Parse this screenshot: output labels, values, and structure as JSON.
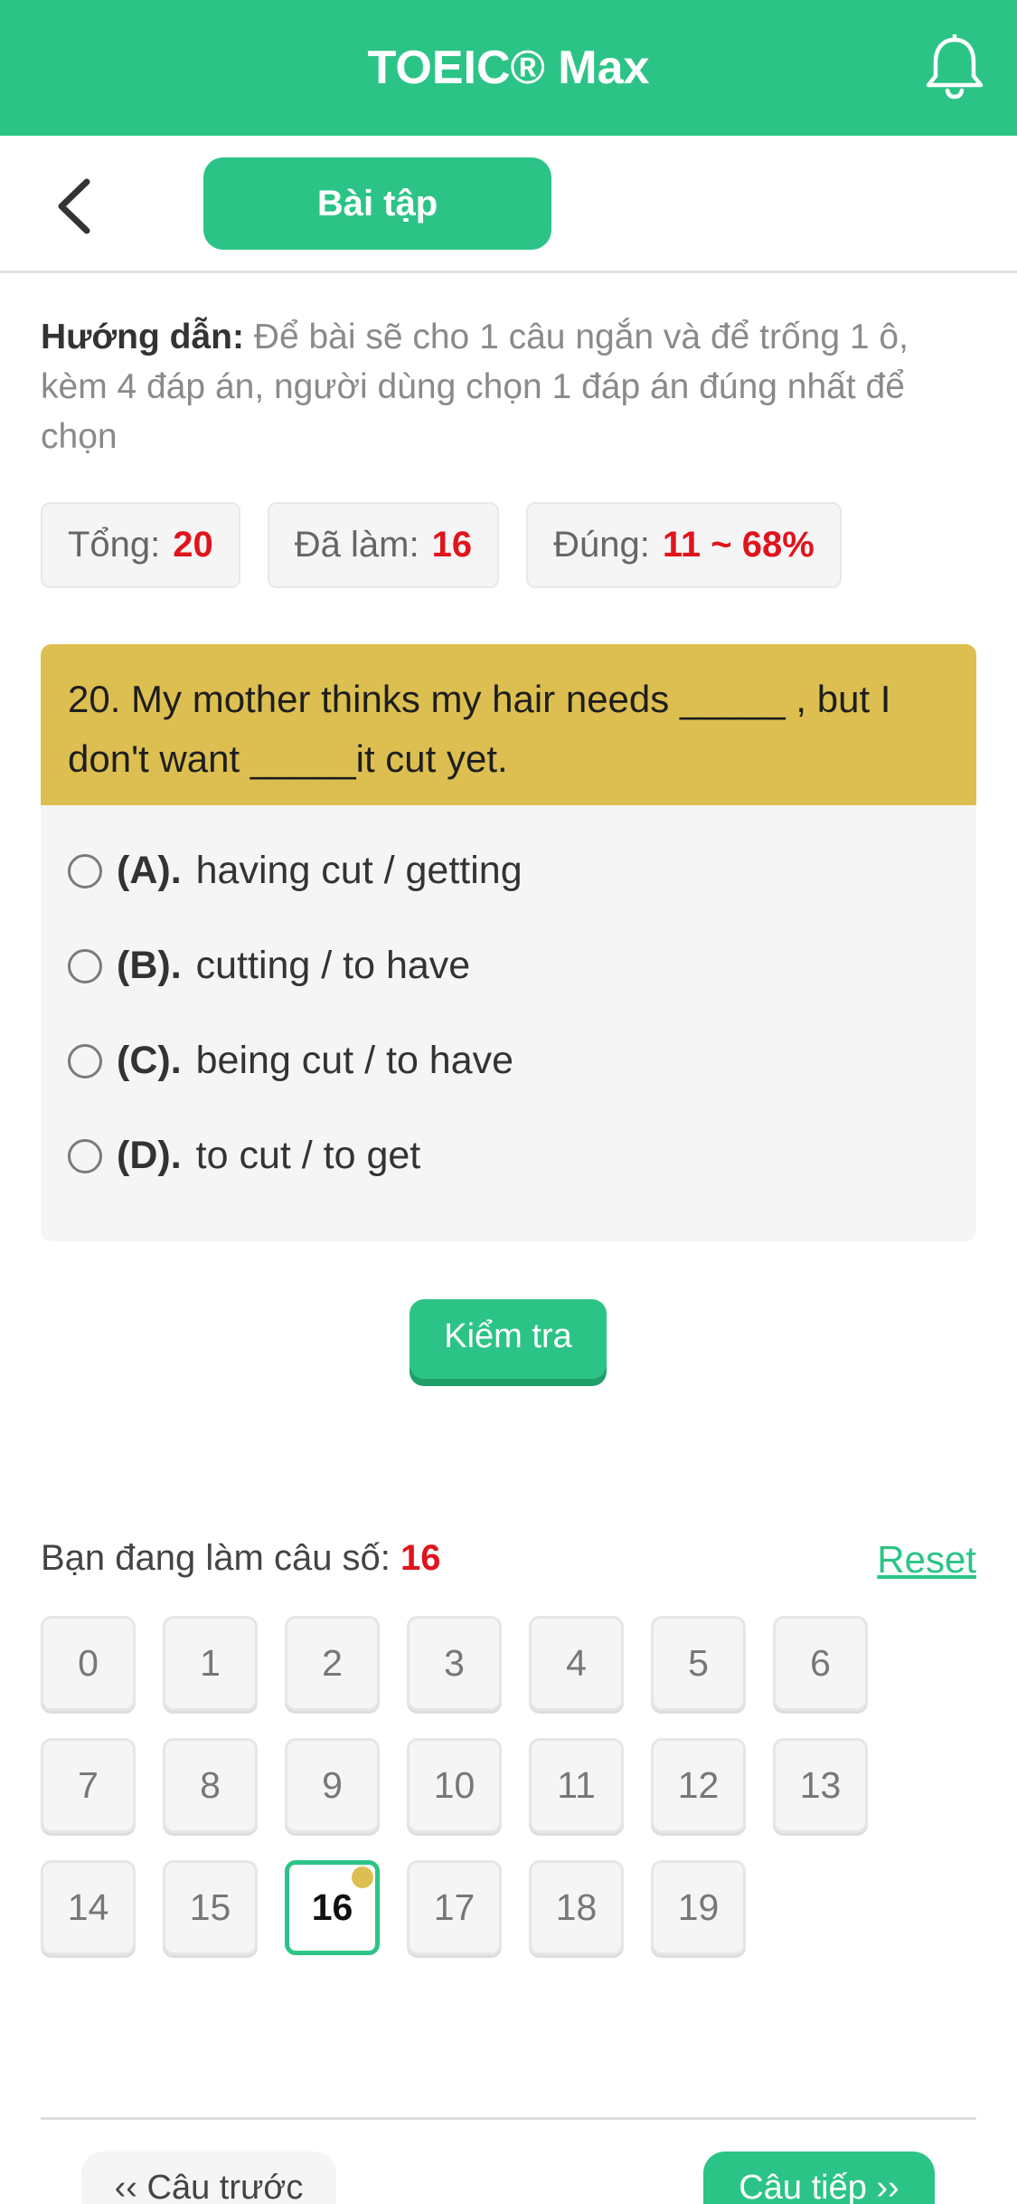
{
  "header": {
    "title": "TOEIC® Max",
    "notification_icon": "bell-icon",
    "brand_color": "#2cc486"
  },
  "subnav": {
    "back_icon": "chevron-left-icon",
    "tab_label": "Bài tập"
  },
  "guide": {
    "label": "Hướng dẫn:",
    "text": " Để bài sẽ cho 1 câu ngắn và để trống 1 ô, kèm 4 đáp án, người dùng chọn 1 đáp án đúng nhất để chọn"
  },
  "stats": [
    {
      "label": "Tổng:",
      "value": "20"
    },
    {
      "label": "Đã làm:",
      "value": "16"
    },
    {
      "label": "Đúng:",
      "value": "11 ~ 68%"
    }
  ],
  "question": {
    "text": "20. My mother thinks my hair needs _____ , but I don't want _____it cut yet.",
    "options": [
      {
        "letter": "(A).",
        "text": "having cut / getting"
      },
      {
        "letter": "(B).",
        "text": "cutting / to have"
      },
      {
        "letter": "(C).",
        "text": "being cut / to have"
      },
      {
        "letter": "(D).",
        "text": "to cut / to get"
      }
    ]
  },
  "check_button": "Kiểm tra",
  "progress": {
    "label": "Bạn đang làm câu số: ",
    "current": "16",
    "reset": "Reset",
    "numbers": [
      "0",
      "1",
      "2",
      "3",
      "4",
      "5",
      "6",
      "7",
      "8",
      "9",
      "10",
      "11",
      "12",
      "13",
      "14",
      "15",
      "16",
      "17",
      "18",
      "19"
    ],
    "active_index": 16
  },
  "footer": {
    "prev": "‹‹ Câu trước",
    "next": "Câu tiếp ››"
  }
}
